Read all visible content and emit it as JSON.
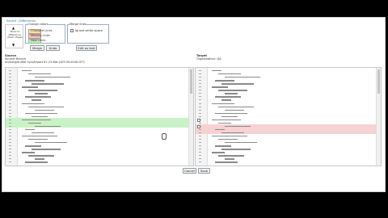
{
  "title": "Source | Differences",
  "nav": {
    "up": "▲",
    "down": "▼",
    "label": "Move to difference. (Num. Page)"
  },
  "change_colors": {
    "title": "Change colors",
    "items": [
      {
        "label": "Changed Lines",
        "color": "#f6e39a"
      },
      {
        "label": "Missing Lines",
        "color": "#f5c2c2"
      },
      {
        "label": "New Lines",
        "color": "#bfeec0"
      }
    ]
  },
  "merge_lines": {
    "title": "Merge lines",
    "checkbox_label": "Ignore white space"
  },
  "buttons": {
    "merge": "Merge",
    "undo": "Undo",
    "edit_as_text": "Edit as text",
    "cancel": "Cancel",
    "save": "Save"
  },
  "source": {
    "title": "Source",
    "subtitle": "Source Branch",
    "info": "Unchanged after Sync/Import R1 (23-Mar-2023 09:43:06 CET)"
  },
  "target": {
    "title": "Target",
    "subtitle": "Organization: QA"
  },
  "colors": {
    "added_bg": "#c9f3c6",
    "removed_bg": "#f6d2d2",
    "accent": "#1a6fb5"
  }
}
